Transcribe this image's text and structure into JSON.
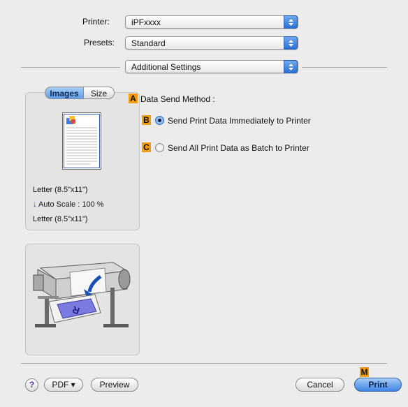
{
  "printer": {
    "label": "Printer:",
    "value": "iPFxxxx"
  },
  "presets": {
    "label": "Presets:",
    "value": "Standard"
  },
  "section": {
    "value": "Additional Settings"
  },
  "preview_panel": {
    "tabs": [
      "Images",
      "Size"
    ],
    "paper_size_top": "Letter (8.5\"x11\")",
    "auto_scale": "Auto Scale : 100 %",
    "paper_size_bottom": "Letter (8.5\"x11\")"
  },
  "settings": {
    "badge_a": "A",
    "title": "Data Send Method :",
    "options": [
      {
        "badge": "B",
        "label": "Send Print Data Immediately to Printer",
        "checked": true
      },
      {
        "badge": "C",
        "label": "Send All Print Data as Batch to Printer",
        "checked": false
      }
    ]
  },
  "footer": {
    "help": "?",
    "pdf": "PDF ▾",
    "preview": "Preview",
    "cancel": "Cancel",
    "print": "Print",
    "badge_m": "M"
  },
  "colors": {
    "badge": "#f39c12",
    "accent": "#3d86e6"
  }
}
